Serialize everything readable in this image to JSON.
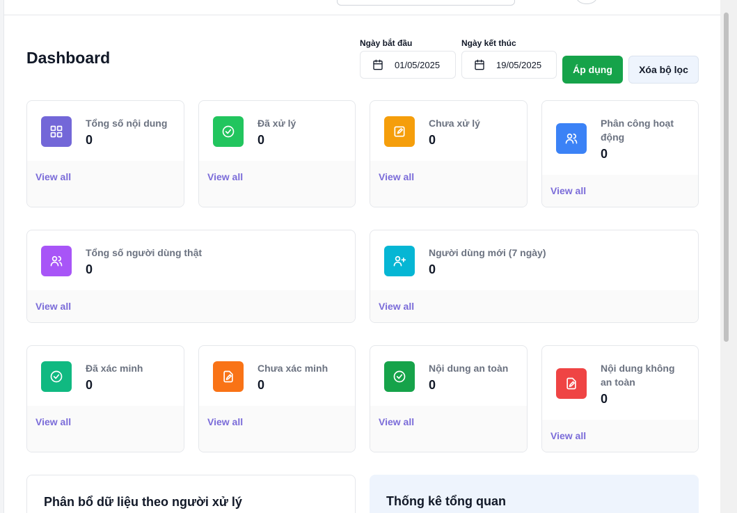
{
  "header": {
    "title": "Dashboard"
  },
  "filters": {
    "start_label": "Ngày bắt đầu",
    "start_value": "01/05/2025",
    "end_label": "Ngày kết thúc",
    "end_value": "19/05/2025",
    "apply_label": "Áp dụng",
    "clear_label": "Xóa bộ lọc"
  },
  "cards": [
    {
      "label": "Tổng số nội dung",
      "value": "0",
      "link": "View all",
      "color": "#7367d8",
      "icon": "grid-icon"
    },
    {
      "label": "Đã xử lý",
      "value": "0",
      "link": "View all",
      "color": "#22c55e",
      "icon": "check-circle-icon"
    },
    {
      "label": "Chưa xử lý",
      "value": "0",
      "link": "View all",
      "color": "#f59e0b",
      "icon": "edit-icon"
    },
    {
      "label_line1": "Phân công hoạt",
      "label_line2": "động",
      "value": "0",
      "link": "View all",
      "color": "#3b82f6",
      "icon": "users-icon"
    },
    {
      "label": "Tổng số người dùng thật",
      "value": "0",
      "link": "View all",
      "color": "#a855f7",
      "icon": "users-icon"
    },
    {
      "label": "Người dùng mới (7 ngày)",
      "value": "0",
      "link": "View all",
      "color": "#06b6d4",
      "icon": "user-plus-icon"
    },
    {
      "label": "Đã xác minh",
      "value": "0",
      "link": "View all",
      "color": "#10b981",
      "icon": "check-circle-icon"
    },
    {
      "label": "Chưa xác minh",
      "value": "0",
      "link": "View all",
      "color": "#f97316",
      "icon": "file-edit-icon"
    },
    {
      "label": "Nội dung an toàn",
      "value": "0",
      "link": "View all",
      "color": "#16a34a",
      "icon": "check-circle-icon"
    },
    {
      "label_line1": "Nội dung không",
      "label_line2": "an toàn",
      "value": "0",
      "link": "View all",
      "color": "#ef4444",
      "icon": "file-edit-icon"
    }
  ],
  "sections": {
    "distribution_title": "Phân bổ dữ liệu theo người xử lý",
    "overview_title": "Thống kê tổng quan"
  }
}
